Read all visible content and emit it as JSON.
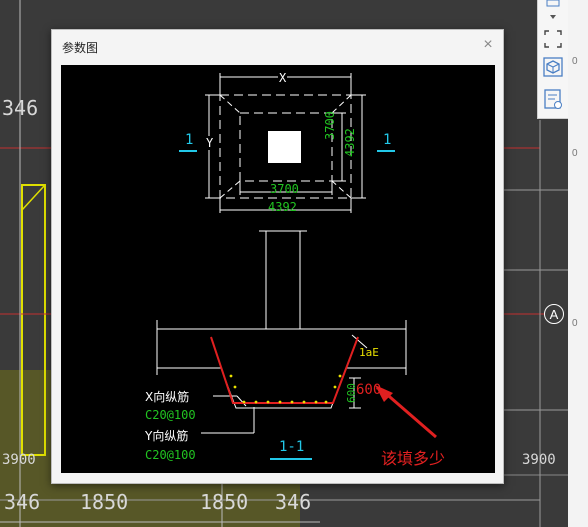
{
  "dialog": {
    "title": "参数图",
    "close_label": "×"
  },
  "drawing": {
    "plan": {
      "x_label": "X",
      "y_label": "Y",
      "section_mark_left": "1",
      "section_mark_right": "1",
      "dim_inner_bottom": "3700",
      "dim_outer_bottom": "4392",
      "dim_inner_right": "3700",
      "dim_outer_right": "4392"
    },
    "section": {
      "lae_label": "1aE",
      "depth_value": "600",
      "x_rebar_label": "X向纵筋",
      "x_rebar_spec": "C20@100",
      "y_rebar_label": "Y向纵筋",
      "y_rebar_spec": "C20@100",
      "section_title": "1-1",
      "dim_vertical": "600"
    },
    "annotation": "该填多少",
    "colors": {
      "dim_green": "#21c421",
      "section_cyan": "#22c8e8",
      "rebar_red": "#e02020",
      "rebar_yellow": "#e8e000",
      "annotation_red": "#e02020"
    }
  },
  "background": {
    "dims_bottom": [
      "346",
      "1850",
      "1850",
      "346"
    ],
    "dim_left_top": "346",
    "dim_left_bottom": "3900",
    "dim_right": "3900",
    "axis_label": "A"
  },
  "toolbar": {
    "icons": [
      "chevron-down-icon",
      "fullscreen-icon",
      "cube-icon",
      "report-icon"
    ]
  }
}
